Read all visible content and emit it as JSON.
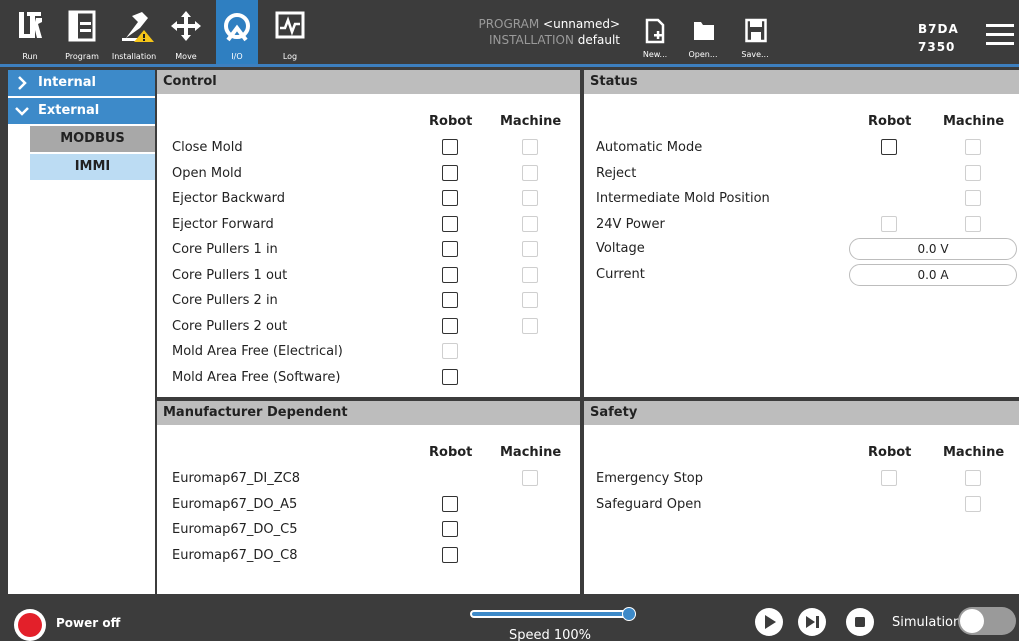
{
  "nav": [
    {
      "label": "Run",
      "icon": "ur-logo-icon"
    },
    {
      "label": "Program",
      "icon": "program-icon"
    },
    {
      "label": "Installation",
      "icon": "installation-icon"
    },
    {
      "label": "Move",
      "icon": "move-icon"
    },
    {
      "label": "I/O",
      "icon": "io-icon"
    },
    {
      "label": "Log",
      "icon": "log-icon"
    }
  ],
  "program_info": {
    "program_key": "PROGRAM",
    "program_value": "<unnamed>",
    "installation_key": "INSTALLATION",
    "installation_value": "default"
  },
  "file_buttons": {
    "new": "New...",
    "open": "Open...",
    "save": "Save..."
  },
  "serial": {
    "line1": "B7DA",
    "line2": "7350"
  },
  "sidebar": {
    "internal": "Internal",
    "external": "External",
    "modbus": "MODBUS",
    "immi": "IMMI"
  },
  "control": {
    "title": "Control",
    "col_robot": "Robot",
    "col_machine": "Machine",
    "rows": [
      {
        "label": "Close Mold",
        "robot": "enabled",
        "machine": "disabled"
      },
      {
        "label": "Open Mold",
        "robot": "enabled",
        "machine": "disabled"
      },
      {
        "label": "Ejector Backward",
        "robot": "enabled",
        "machine": "disabled"
      },
      {
        "label": "Ejector Forward",
        "robot": "enabled",
        "machine": "disabled"
      },
      {
        "label": "Core Pullers 1 in",
        "robot": "enabled",
        "machine": "disabled"
      },
      {
        "label": "Core Pullers 1 out",
        "robot": "enabled",
        "machine": "disabled"
      },
      {
        "label": "Core Pullers 2 in",
        "robot": "enabled",
        "machine": "disabled"
      },
      {
        "label": "Core Pullers 2 out",
        "robot": "enabled",
        "machine": "disabled"
      },
      {
        "label": "Mold Area Free (Electrical)",
        "robot": "disabled",
        "machine": "none"
      },
      {
        "label": "Mold Area Free (Software)",
        "robot": "enabled",
        "machine": "none"
      }
    ]
  },
  "status": {
    "title": "Status",
    "col_robot": "Robot",
    "col_machine": "Machine",
    "rows": [
      {
        "label": "Automatic Mode",
        "robot": "enabled",
        "machine": "disabled"
      },
      {
        "label": "Reject",
        "robot": "none",
        "machine": "disabled"
      },
      {
        "label": "Intermediate Mold Position",
        "robot": "none",
        "machine": "disabled"
      },
      {
        "label": "24V Power",
        "robot": "disabled",
        "machine": "disabled"
      }
    ],
    "voltage_label": "Voltage",
    "voltage_value": "0.0 V",
    "current_label": "Current",
    "current_value": "0.0 A"
  },
  "manufacturer": {
    "title": "Manufacturer Dependent",
    "col_robot": "Robot",
    "col_machine": "Machine",
    "rows": [
      {
        "label": "Euromap67_DI_ZC8",
        "robot": "none",
        "machine": "disabled"
      },
      {
        "label": "Euromap67_DO_A5",
        "robot": "enabled",
        "machine": "none"
      },
      {
        "label": "Euromap67_DO_C5",
        "robot": "enabled",
        "machine": "none"
      },
      {
        "label": "Euromap67_DO_C8",
        "robot": "enabled",
        "machine": "none"
      }
    ]
  },
  "safety": {
    "title": "Safety",
    "col_robot": "Robot",
    "col_machine": "Machine",
    "rows": [
      {
        "label": "Emergency Stop",
        "robot": "disabled",
        "machine": "disabled"
      },
      {
        "label": "Safeguard Open",
        "robot": "none",
        "machine": "disabled"
      }
    ]
  },
  "footer": {
    "power_label": "Power off",
    "speed_label": "Speed 100%",
    "speed_value": 1.0,
    "simulation_label": "Simulation"
  },
  "colors": {
    "accent": "#3d8ac9",
    "header_bg": "#3c3c3c",
    "panel_header": "#bdbdbd",
    "power_off": "#e3202a",
    "sidebar_selected": "#bcdcf3",
    "sidebar_sub": "#a8a8a8"
  }
}
